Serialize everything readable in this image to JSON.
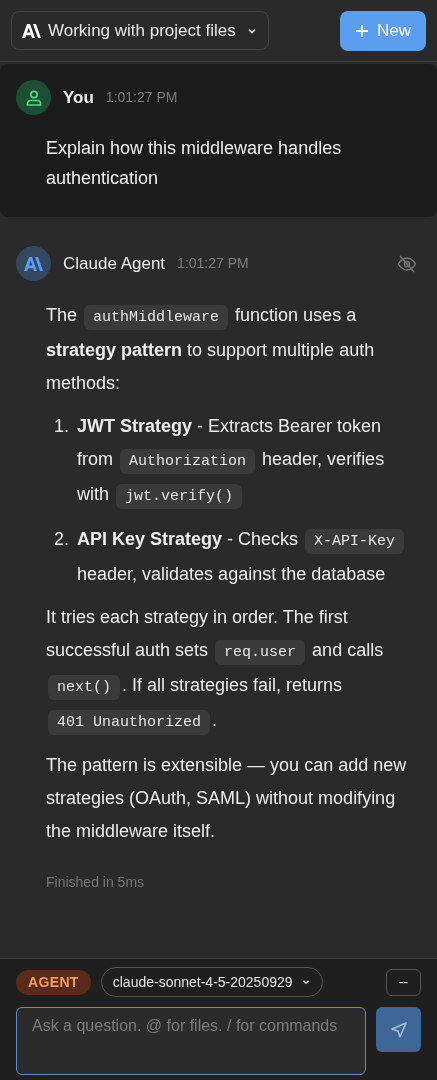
{
  "header": {
    "title": "Working with project files",
    "new_button": "New"
  },
  "user_message": {
    "author": "You",
    "time": "1:01:27 PM",
    "text": "Explain how this middleware handles authentication"
  },
  "agent_message": {
    "author": "Claude Agent",
    "time": "1:01:27 PM",
    "hidden": true,
    "blocks": [
      {
        "kind": "paragraph",
        "segments": [
          {
            "kind": "text",
            "text": "The "
          },
          {
            "kind": "code",
            "text": "authMiddleware"
          },
          {
            "kind": "text",
            "text": " function uses a **strategy pattern** to support multiple auth methods:"
          }
        ]
      },
      {
        "kind": "item",
        "number": "1.",
        "segments": [
          {
            "kind": "text",
            "text": "**JWT Strategy** - Extracts Bearer token from "
          },
          {
            "kind": "code",
            "text": "Authorization"
          },
          {
            "kind": "text",
            "text": " header, verifies with "
          },
          {
            "kind": "code",
            "text": "jwt.verify()"
          }
        ]
      },
      {
        "kind": "item",
        "number": "2.",
        "segments": [
          {
            "kind": "text",
            "text": "**API Key Strategy** - Checks "
          },
          {
            "kind": "code",
            "text": "X-API-Key"
          },
          {
            "kind": "text",
            "text": " header, validates against the database"
          }
        ]
      },
      {
        "kind": "paragraph",
        "segments": [
          {
            "kind": "text",
            "text": "It tries each strategy in order. The first successful auth sets "
          },
          {
            "kind": "code",
            "text": "req.user"
          },
          {
            "kind": "text",
            "text": " and calls "
          },
          {
            "kind": "code",
            "text": "next()"
          },
          {
            "kind": "text",
            "text": ". If all strategies fail, returns "
          },
          {
            "kind": "code",
            "text": "401 Unauthorized"
          },
          {
            "kind": "text",
            "text": "."
          }
        ]
      },
      {
        "kind": "paragraph",
        "segments": [
          {
            "kind": "text",
            "text": "The pattern is extensible — you can add new strategies (OAuth, SAML) without modifying the middleware itself."
          }
        ]
      }
    ],
    "status": "Finished in 5ms"
  },
  "composer": {
    "mode": "AGENT",
    "model": "claude-sonnet-4-5-20250929",
    "extra": "--",
    "placeholder": "Ask a question. @ for files. / for commands"
  }
}
